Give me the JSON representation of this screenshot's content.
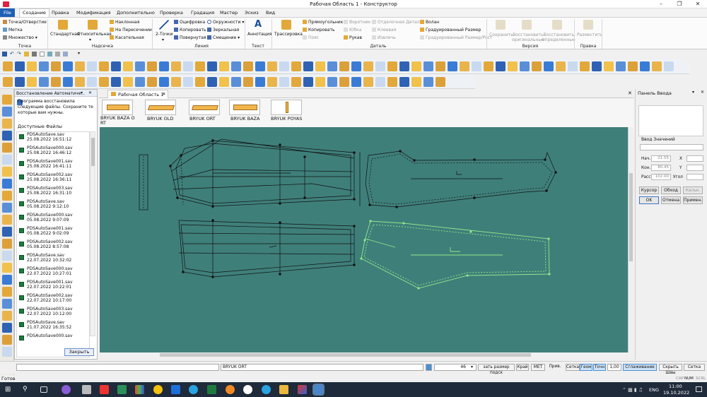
{
  "window": {
    "title": "Рабочая Область 1 - Конструктор"
  },
  "menu": [
    "File",
    "Создание",
    "Правка",
    "Модификация",
    "Дополнительно",
    "Проверка",
    "Градация",
    "Мастер",
    "Эскиз",
    "Вид"
  ],
  "ribbon": {
    "nadsechka": [
      "Точка/Отверстие",
      "Метка",
      "Множество"
    ],
    "big": [
      "Стандартная",
      "Относительная"
    ],
    "nadsechka2": [
      "Наклонная",
      "На Пересечении",
      "Касательная"
    ],
    "liniya_big": "2-Точки",
    "liniya_col1": [
      "Оцифровка",
      "Копировать",
      "Повернутая"
    ],
    "liniya_col2": [
      "Окружности",
      "Зеркальная",
      "Смещение"
    ],
    "tekst": "Аннотация",
    "trassirovka": "Трассировка",
    "detal_col1": [
      "Прямоугольник",
      "Копировать",
      "Пояс"
    ],
    "detal_col2": [
      "Воротник",
      "Юбка",
      "Рукав"
    ],
    "detal_col3": [
      "Отделочная Деталь",
      "Клеевая",
      "Извлечь"
    ],
    "detal_col4": [
      "Волан",
      "Градуированный Размер",
      "Градуированный Размер/Рост"
    ],
    "versiya": [
      "Сохранить",
      "Восстановить оригинальные",
      "Восстановить определенные"
    ],
    "pravka": "Разместить",
    "groups": [
      "Точка",
      "Надсечка",
      "Линия",
      "Текст",
      "Деталь",
      "Версия",
      "Правка"
    ]
  },
  "recovery": {
    "title": "Восстановление Автоматиче...",
    "message": "Программа восстановила следующие файлы. Сохраните те которые вам нужны.",
    "available": "Доступные Файлы",
    "files": [
      {
        "name": "PDSAutoSave.sav",
        "date": "25.08.2022 16:51:12"
      },
      {
        "name": "PDSAutoSave000.sav",
        "date": "25.08.2022 16:46:12"
      },
      {
        "name": "PDSAutoSave001.sav",
        "date": "25.08.2022 16:41:11"
      },
      {
        "name": "PDSAutoSave002.sav",
        "date": "25.08.2022 16:36:11"
      },
      {
        "name": "PDSAutoSave003.sav",
        "date": "25.08.2022 16:31:10"
      },
      {
        "name": "PDSAutoSave.sav",
        "date": "05.08.2022 9:12:10"
      },
      {
        "name": "PDSAutoSave000.sav",
        "date": "05.08.2022 9:07:09"
      },
      {
        "name": "PDSAutoSave001.sav",
        "date": "05.08.2022 9:02:09"
      },
      {
        "name": "PDSAutoSave002.sav",
        "date": "05.08.2022 8:57:08"
      },
      {
        "name": "PDSAutoSave.sav",
        "date": "22.07.2022 10:32:02"
      },
      {
        "name": "PDSAutoSave000.sav",
        "date": "22.07.2022 10:27:01"
      },
      {
        "name": "PDSAutoSave001.sav",
        "date": "22.07.2022 10:22:01"
      },
      {
        "name": "PDSAutoSave002.sav",
        "date": "22.07.2022 10:17:00"
      },
      {
        "name": "PDSAutoSave003.sav",
        "date": "22.07.2022 10:12:00"
      },
      {
        "name": "PDSAutoSave.sav",
        "date": "21.07.2022 16:35:52"
      },
      {
        "name": "PDSAutoSave000.sav",
        "date": ""
      }
    ],
    "close": "Закрыть"
  },
  "workspace": {
    "tab": "Рабочая Область 1"
  },
  "pieces": [
    "BRYUK BAZA O RT",
    "BRYUK OLD",
    "BRYUK ORT",
    "BRYUK BAZA",
    "BRYUK POYAS"
  ],
  "input_panel": {
    "title": "Панель Ввода",
    "values_label": "Ввод Значений",
    "start_label": "Нач.",
    "start_val": "21.55",
    "x": "X",
    "end_label": "Кон.",
    "end_val": "80.45",
    "y": "Y",
    "dist_label": "Расс",
    "dist_val": "102.00",
    "angle": "Угол",
    "cursor": "Курсор",
    "snap": "Обход",
    "calc": "Кальк.",
    "ok": "OK",
    "cancel": "Отмена",
    "apply": "Примен."
  },
  "status": {
    "piece": "BRYUK ORT",
    "num": "46",
    "size_label": "зать размер подск",
    "krai": "Край",
    "met": "МЕТ",
    "priv": "Прив.",
    "setka": "Сетка",
    "geom": "Геом",
    "tochn": "Точн",
    "step": "1,00",
    "sglazh": "Сглаживание",
    "skryt": "Скрыть Швы",
    "setka2": "Сетка",
    "ready": "Готов"
  },
  "tray": {
    "cap": "CAP",
    "num": "NUM",
    "scrl": "SCRL",
    "lang": "ENG",
    "time": "11:00",
    "date": "19.10.2022"
  }
}
